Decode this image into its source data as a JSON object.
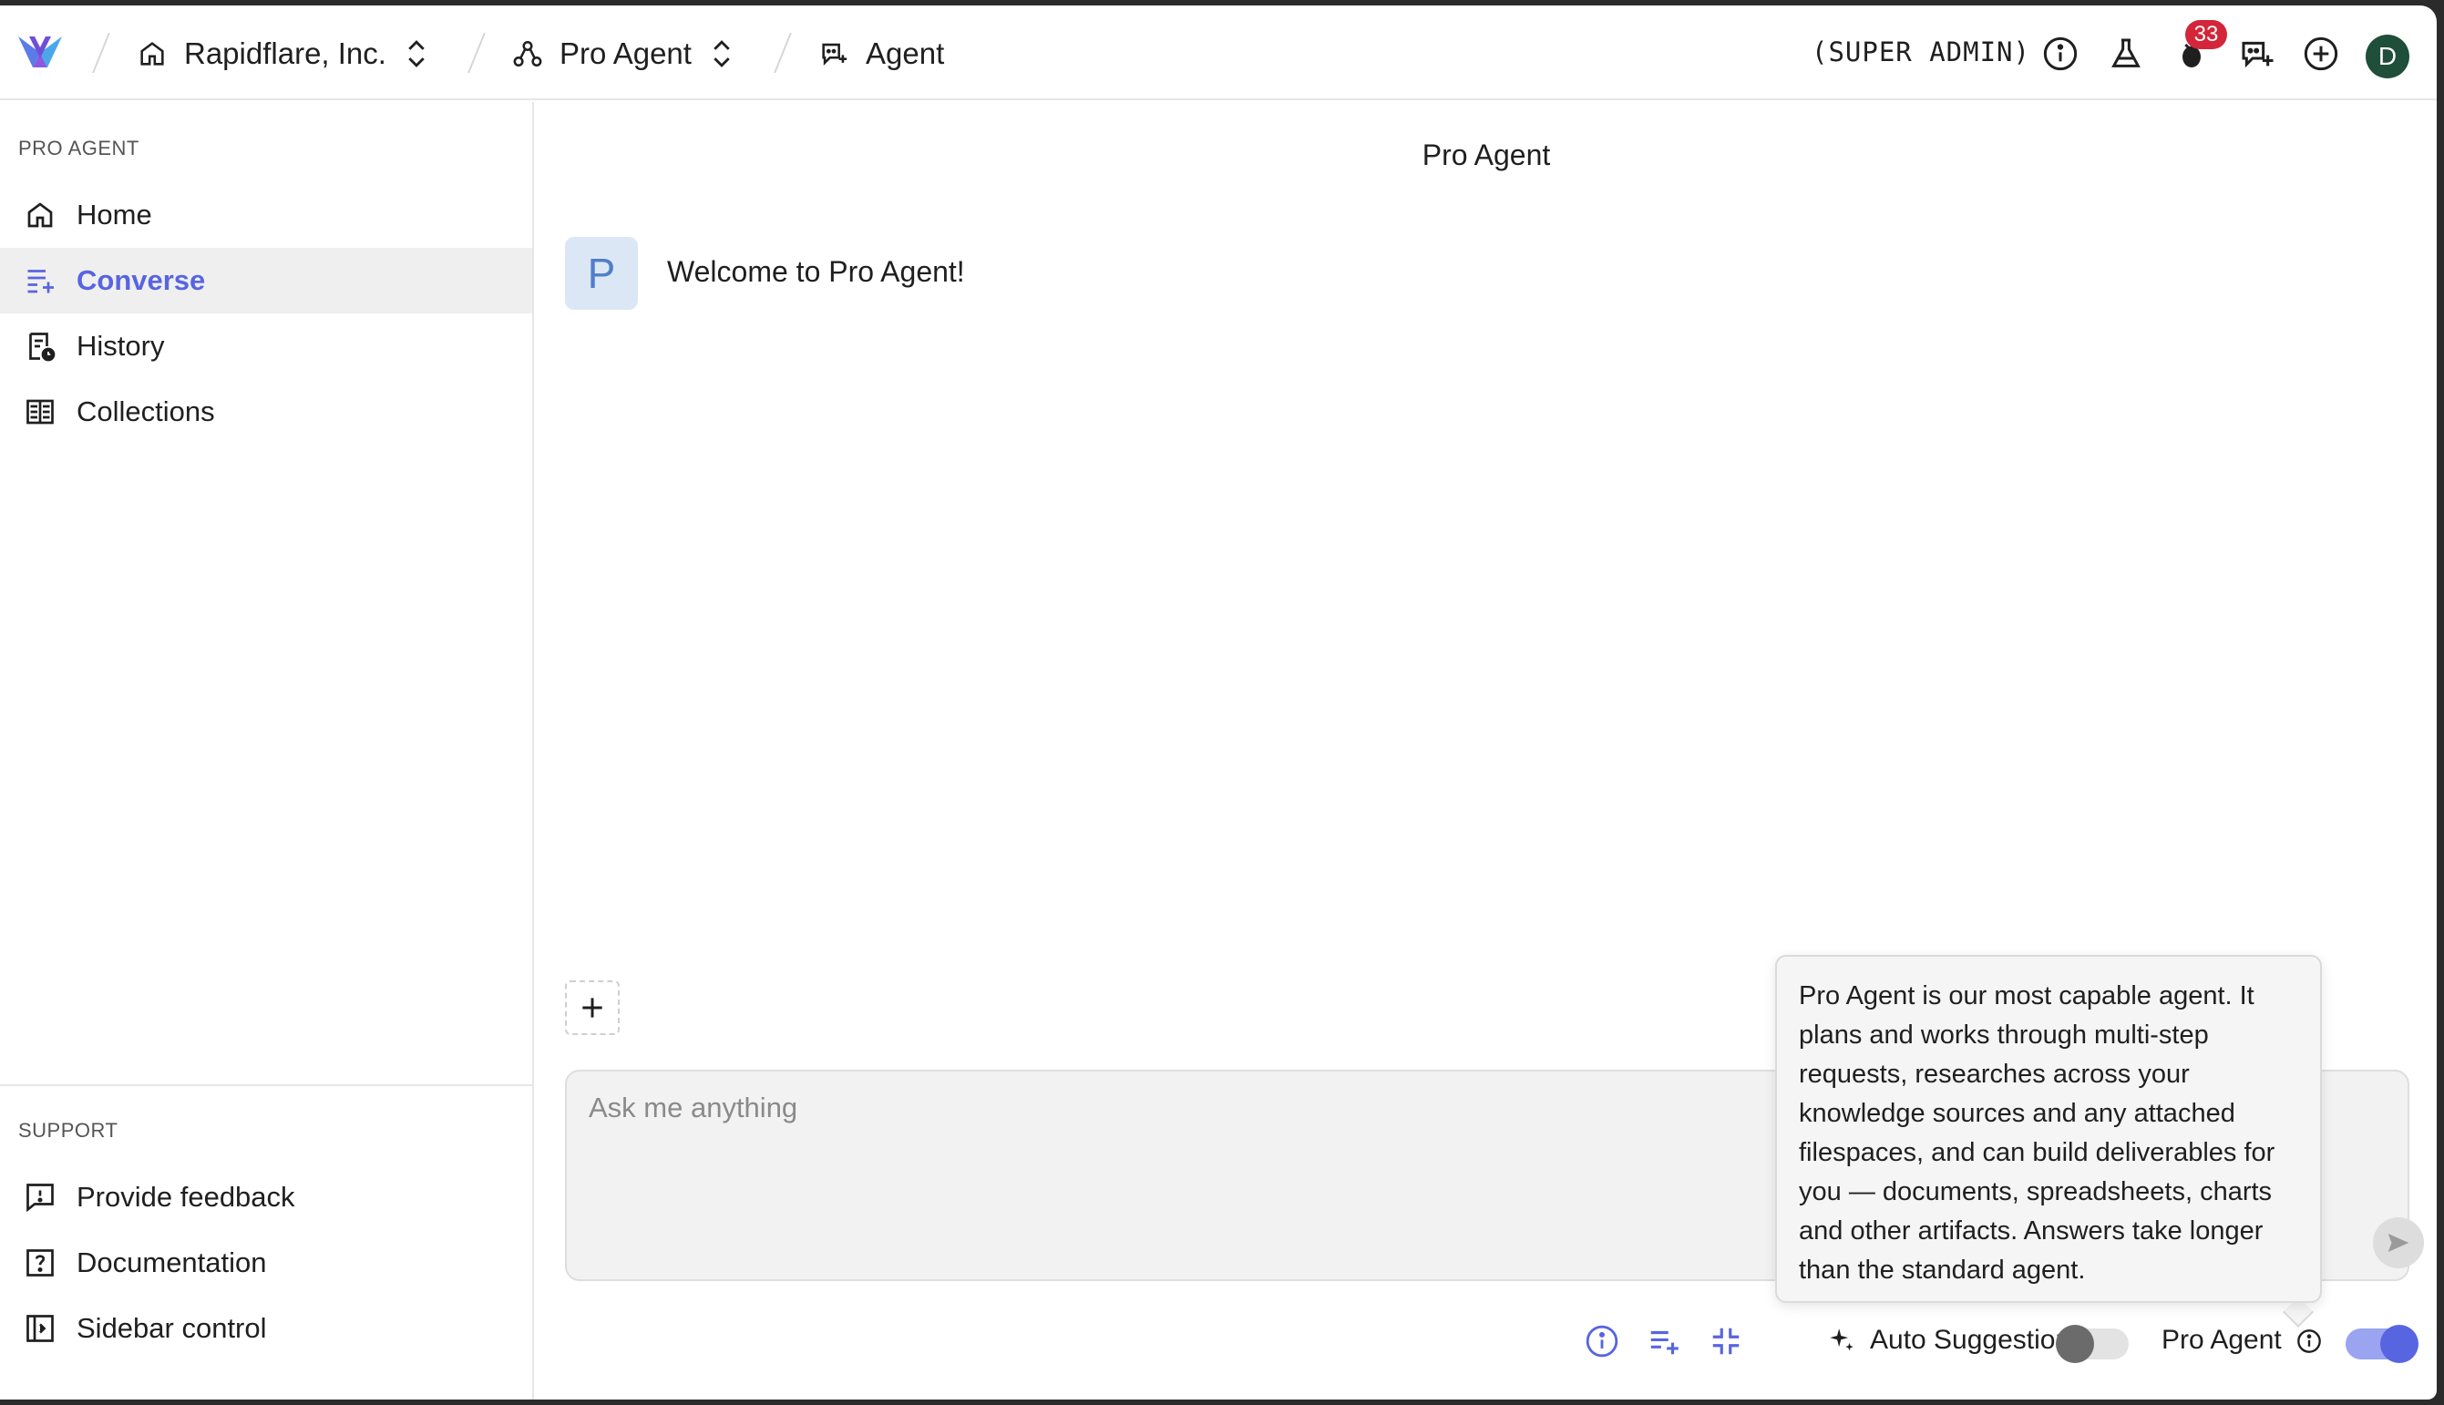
{
  "topbar": {
    "org": "Rapidflare, Inc.",
    "project": "Pro Agent",
    "page": "Agent",
    "role": "(SUPER ADMIN)",
    "notification_count": "33",
    "avatar_initial": "D"
  },
  "sidebar": {
    "section_title": "PRO AGENT",
    "items": [
      {
        "label": "Home",
        "icon": "home-icon"
      },
      {
        "label": "Converse",
        "icon": "converse-icon",
        "active": true
      },
      {
        "label": "History",
        "icon": "history-icon"
      },
      {
        "label": "Collections",
        "icon": "collections-icon"
      }
    ],
    "support_title": "SUPPORT",
    "support_items": [
      {
        "label": "Provide feedback",
        "icon": "feedback-icon"
      },
      {
        "label": "Documentation",
        "icon": "documentation-icon"
      },
      {
        "label": "Sidebar control",
        "icon": "sidebar-control-icon"
      }
    ]
  },
  "main": {
    "title": "Pro Agent",
    "message": {
      "avatar": "P",
      "text": "Welcome to Pro Agent!"
    },
    "input_placeholder": "Ask me anything",
    "auto_suggestions_label": "Auto Suggestions",
    "pro_agent_label": "Pro Agent",
    "tooltip": "Pro Agent is our most capable agent. It plans and works through multi-step requests, researches across your knowledge sources and any attached filespaces, and can build deliverables for you — documents, spreadsheets, charts and other artifacts. Answers take longer than the standard agent."
  },
  "colors": {
    "accent": "#5865e0",
    "badge": "#d3263a",
    "avatar": "#1f4e3a"
  }
}
